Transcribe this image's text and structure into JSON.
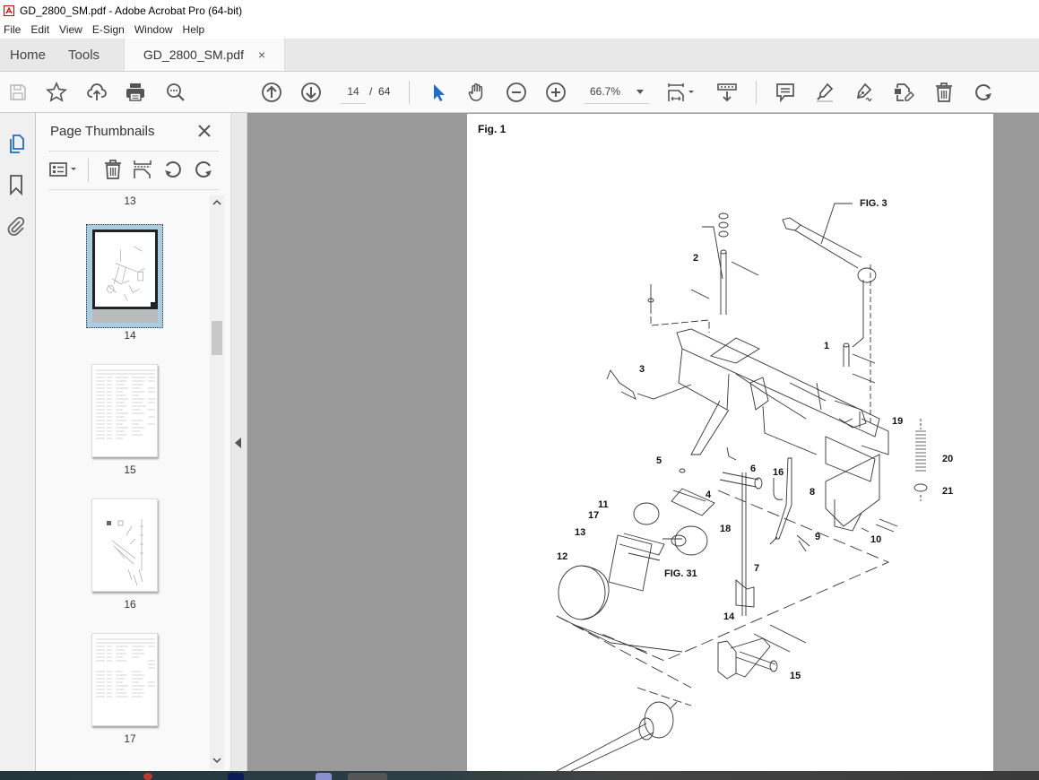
{
  "window": {
    "title": "GD_2800_SM.pdf - Adobe Acrobat Pro (64-bit)",
    "app_icon": "acrobat-icon"
  },
  "menu": [
    "File",
    "Edit",
    "View",
    "E-Sign",
    "Window",
    "Help"
  ],
  "tabs": {
    "home": "Home",
    "tools": "Tools",
    "document": "GD_2800_SM.pdf",
    "close_glyph": "×"
  },
  "toolbar": {
    "left_icons": [
      "save-icon",
      "bookmark-star-icon",
      "upload-cloud-icon",
      "print-icon",
      "search-zoom-icon"
    ],
    "nav_icons": [
      "previous-page-icon",
      "next-page-icon"
    ],
    "current_page": "14",
    "page_separator": "/",
    "total_pages": "64",
    "tools_icons": [
      "select-arrow-icon",
      "hand-tool-icon",
      "zoom-out-icon",
      "zoom-in-icon"
    ],
    "zoom_level": "66.7%",
    "view_icons": [
      "fit-page-icon",
      "scroll-mode-icon"
    ],
    "edit_icons": [
      "comment-icon",
      "highlight-icon",
      "sign-icon",
      "edit-pdf-icon",
      "delete-icon",
      "rotate-icon"
    ]
  },
  "left_rail": {
    "items": [
      "page-thumbnails-icon",
      "bookmarks-icon",
      "attachments-icon"
    ],
    "active": "page-thumbnails-icon"
  },
  "thumbnail_panel": {
    "title": "Page Thumbnails",
    "close_glyph": "✕",
    "toolbar_icons": [
      "options-menu-icon",
      "delete-pages-icon",
      "insert-pages-icon",
      "rotate-ccw-icon",
      "rotate-cw-icon"
    ],
    "pages": [
      {
        "label": "13",
        "kind": "partial"
      },
      {
        "label": "14",
        "kind": "drawing",
        "selected": true
      },
      {
        "label": "15",
        "kind": "table"
      },
      {
        "label": "16",
        "kind": "drawing"
      },
      {
        "label": "17",
        "kind": "table"
      }
    ]
  },
  "document": {
    "figure_title": "Fig. 1",
    "callouts": [
      "FIG. 3",
      "2",
      "1",
      "3",
      "19",
      "20",
      "21",
      "5",
      "6",
      "16",
      "4",
      "8",
      "11",
      "17",
      "18",
      "9",
      "10",
      "13",
      "12",
      "FIG. 31",
      "7",
      "14",
      "15"
    ]
  }
}
